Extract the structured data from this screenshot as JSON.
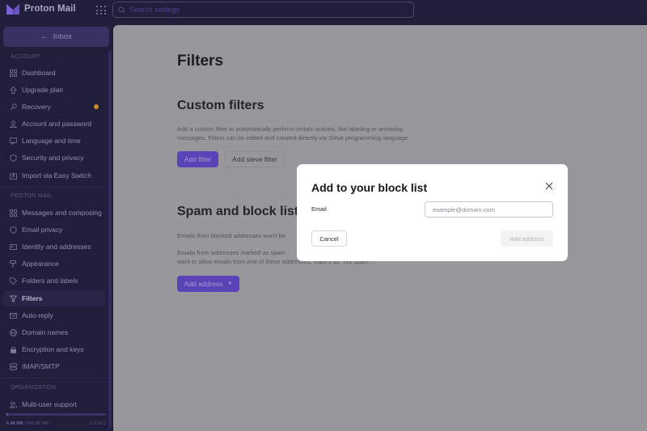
{
  "app": {
    "name": "Proton Mail",
    "brand_color": "#6d4aff"
  },
  "header": {
    "search_placeholder": "Search settings"
  },
  "sidebar": {
    "back_button": "Inbox",
    "sections": [
      {
        "title": "ACCOUNT",
        "items": [
          {
            "label": "Dashboard",
            "icon": "grid-icon"
          },
          {
            "label": "Upgrade plan",
            "icon": "arrow-up-icon"
          },
          {
            "label": "Recovery",
            "icon": "key-icon",
            "notification": true
          },
          {
            "label": "Account and password",
            "icon": "user-icon"
          },
          {
            "label": "Language and time",
            "icon": "language-icon"
          },
          {
            "label": "Security and privacy",
            "icon": "shield-icon"
          },
          {
            "label": "Import via Easy Switch",
            "icon": "import-icon"
          }
        ]
      },
      {
        "title": "PROTON MAIL",
        "items": [
          {
            "label": "Messages and composing",
            "icon": "grid-icon"
          },
          {
            "label": "Email privacy",
            "icon": "shield-icon"
          },
          {
            "label": "Identity and addresses",
            "icon": "card-icon"
          },
          {
            "label": "Appearance",
            "icon": "paint-roller-icon"
          },
          {
            "label": "Folders and labels",
            "icon": "tag-icon"
          },
          {
            "label": "Filters",
            "icon": "filter-icon",
            "active": true
          },
          {
            "label": "Auto-reply",
            "icon": "envelope-icon"
          },
          {
            "label": "Domain names",
            "icon": "globe-icon"
          },
          {
            "label": "Encryption and keys",
            "icon": "lock-icon"
          },
          {
            "label": "IMAP/SMTP",
            "icon": "servers-icon"
          }
        ]
      },
      {
        "title": "ORGANIZATION",
        "items": [
          {
            "label": "Multi-user support",
            "icon": "users-icon"
          }
        ]
      }
    ],
    "storage": {
      "used": "6.48 MB",
      "separator": " / ",
      "total": "500.00 MB",
      "fraction_used": 0.013
    },
    "version": "5.0.16.2"
  },
  "main": {
    "title": "Filters",
    "custom_filters": {
      "heading": "Custom filters",
      "description_line1": "Add a custom filter to automatically perform certain actions, like labeling or archiving",
      "description_line2": "messages. Filters can be edited and created directly via Sieve programming language.",
      "add_filter": "Add filter",
      "add_sieve_filter": "Add sieve filter"
    },
    "spam_block": {
      "heading": "Spam and block list",
      "line1": "Emails from blocked addresses won't be",
      "line2": "Emails from addresses marked as spam",
      "line3": "want to allow emails from one of these addresses, mark it as \"not spam\".",
      "add_address": "Add address"
    }
  },
  "modal": {
    "title": "Add to your block list",
    "email_label": "Email",
    "email_placeholder": "example@domain.com",
    "email_value": "",
    "cancel": "Cancel",
    "submit": "Add address"
  }
}
